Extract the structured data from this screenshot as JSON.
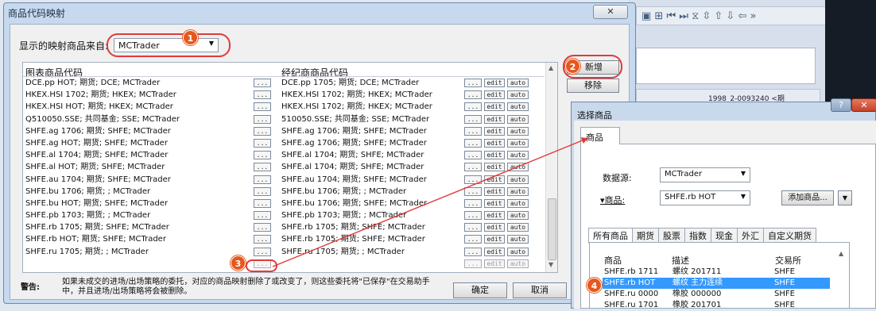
{
  "main_dialog": {
    "title": "商品代码映射",
    "close_glyph": "✕",
    "source_label": "显示的映射商品来自:",
    "source_value": "MCTrader",
    "col_chart": "图表商品代码",
    "col_broker": "经纪商商品代码",
    "btn_ellipsis": "...",
    "btn_edit": "edit",
    "btn_auto": "auto",
    "rows": [
      {
        "chart": "DCE.pp HOT; 期货; DCE; MCTrader",
        "broker": "DCE.pp 1705; 期货; DCE; MCTrader"
      },
      {
        "chart": "HKEX.HSI 1702; 期货; HKEX; MCTrader",
        "broker": "HKEX.HSI 1702; 期货; HKEX; MCTrader"
      },
      {
        "chart": "HKEX.HSI HOT; 期货; HKEX; MCTrader",
        "broker": "HKEX.HSI 1702; 期货; HKEX; MCTrader"
      },
      {
        "chart": "Q510050.SSE; 共同基金; SSE; MCTrader",
        "broker": "510050.SSE; 共同基金; SSE; MCTrader"
      },
      {
        "chart": "SHFE.ag 1706; 期货; SHFE; MCTrader",
        "broker": "SHFE.ag 1706; 期货; SHFE; MCTrader"
      },
      {
        "chart": "SHFE.ag HOT; 期货; SHFE; MCTrader",
        "broker": "SHFE.ag 1706; 期货; SHFE; MCTrader"
      },
      {
        "chart": "SHFE.al 1704; 期货; SHFE; MCTrader",
        "broker": "SHFE.al 1704; 期货; SHFE; MCTrader"
      },
      {
        "chart": "SHFE.al HOT; 期货; SHFE; MCTrader",
        "broker": "SHFE.al 1704; 期货; SHFE; MCTrader"
      },
      {
        "chart": "SHFE.au 1704; 期货; SHFE; MCTrader",
        "broker": "SHFE.au 1704; 期货; SHFE; MCTrader"
      },
      {
        "chart": "SHFE.bu 1706; 期货; ; MCTrader",
        "broker": "SHFE.bu 1706; 期货; ; MCTrader"
      },
      {
        "chart": "SHFE.bu HOT; 期货; SHFE; MCTrader",
        "broker": "SHFE.bu 1706; 期货; SHFE; MCTrader"
      },
      {
        "chart": "SHFE.pb 1703; 期货; ; MCTrader",
        "broker": "SHFE.pb 1703; 期货; ; MCTrader"
      },
      {
        "chart": "SHFE.rb 1705; 期货; SHFE; MCTrader",
        "broker": "SHFE.rb 1705; 期货; SHFE; MCTrader"
      },
      {
        "chart": "SHFE.rb HOT; 期货; SHFE; MCTrader",
        "broker": "SHFE.rb 1705; 期货; SHFE; MCTrader"
      },
      {
        "chart": "SHFE.ru 1705; 期货; ; MCTrader",
        "broker": "SHFE.ru 1705; 期货; ; MCTrader"
      },
      {
        "chart": "",
        "broker": ""
      }
    ],
    "add_button": "新增",
    "remove_button": "移除",
    "warning_label": "警告:",
    "warning_text": "如果未成交的进场/出场策略的委托，对应的商品映射删除了或改变了，则这些委托将\"已保存\"在交易助手中，并且进场/出场策略将会被删除。",
    "ok_button": "确定",
    "cancel_button": "取消"
  },
  "badges": {
    "b1": "1",
    "b2": "2",
    "b3": "3",
    "b4": "4"
  },
  "background_app": {
    "toolbar_glyphs": "▣ ⊞  ⏮ ⏭ ⧖ ⇳ ⇧ ⇩ ⇦  »",
    "strip_text": "1998_2-0093240",
    "strip_label": "<期"
  },
  "select_dialog": {
    "title": "选择商品",
    "help": "?",
    "close": "✕",
    "tab": "商品",
    "datasource_label": "数据源:",
    "datasource_value": "MCTrader",
    "product_label": "▾商品:",
    "product_value": "SHFE.rb HOT",
    "add_product_button": "添加商品...",
    "category_tabs": [
      "所有商品",
      "期货",
      "股票",
      "指数",
      "现金",
      "外汇",
      "自定义期货"
    ],
    "list_headers": {
      "product": "商品",
      "desc": "描述",
      "exchange": "交易所"
    },
    "list_rows": [
      {
        "product": "SHFE.rb 1711",
        "desc": "螺纹 201711",
        "exchange": "SHFE"
      },
      {
        "product": "SHFE.rb HOT",
        "desc": "螺纹 主力连续",
        "exchange": "SHFE"
      },
      {
        "product": "SHFE.ru 0000",
        "desc": "橡胶 000000",
        "exchange": "SHFE"
      },
      {
        "product": "SHFE.ru 1701",
        "desc": "橡胶 201701",
        "exchange": "SHFE"
      }
    ]
  },
  "colors": {
    "highlight": "#e13a3a",
    "badge": "#e5581f",
    "selection": "#3399ff"
  }
}
